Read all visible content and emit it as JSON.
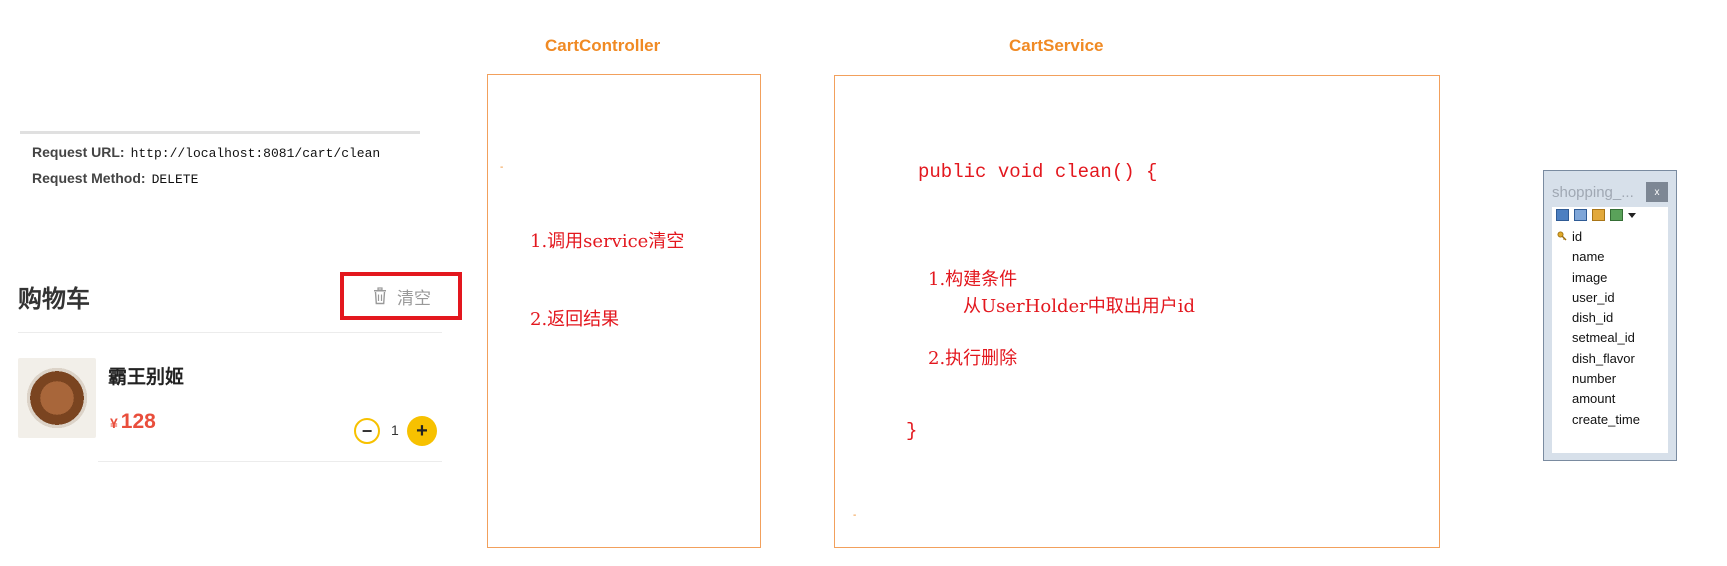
{
  "request": {
    "url_label": "Request URL:",
    "url_value": "http://localhost:8081/cart/clean",
    "method_label": "Request Method:",
    "method_value": "DELETE"
  },
  "cart": {
    "title": "购物车",
    "clear_label": "清空",
    "item": {
      "name": "霸王别姬",
      "currency": "¥",
      "price": "128",
      "quantity": "1"
    },
    "icons": {
      "clear": "trash-icon",
      "minus": "minus-icon",
      "plus": "plus-icon"
    },
    "highlight_color": "#e3171e",
    "accent_color": "#f7c100"
  },
  "controller": {
    "title": "CartController",
    "steps": [
      "1.调用service清空",
      "2.返回结果"
    ]
  },
  "service": {
    "title": "CartService",
    "signature": "public void clean() {",
    "step1": "1.构建条件",
    "step1_detail": "从UserHolder中取出用户id",
    "step2": "2.执行删除",
    "closing": "}"
  },
  "db_table": {
    "title": "shopping_...",
    "close": "x",
    "fields": [
      "id",
      "name",
      "image",
      "user_id",
      "dish_id",
      "setmeal_id",
      "dish_flavor",
      "number",
      "amount",
      "create_time"
    ]
  },
  "colors": {
    "box_title": "#f08a24",
    "box_border": "#f2a05c",
    "annotation": "#e3171e"
  }
}
